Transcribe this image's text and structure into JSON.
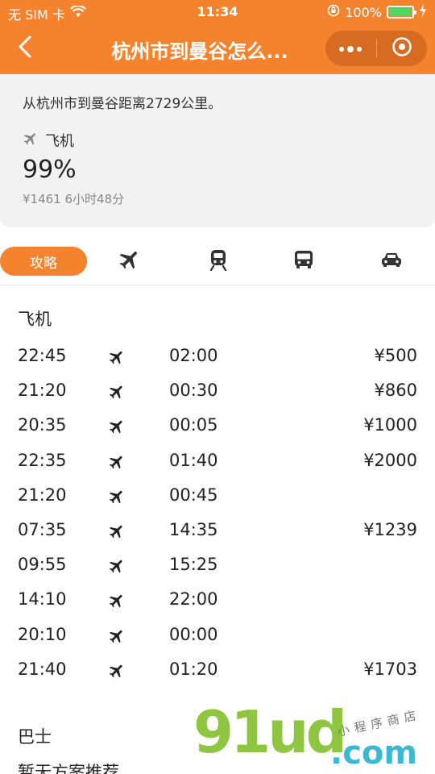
{
  "status_bar": {
    "carrier": "无 SIM 卡",
    "time": "11:34",
    "battery": "100%"
  },
  "nav": {
    "title": "杭州市到曼谷怎么..."
  },
  "summary": {
    "distance_text": "从杭州市到曼谷距离2729公里。",
    "mode_label": "飞机",
    "percent": "99%",
    "meta": "¥1461 6小时48分"
  },
  "tabs": {
    "guide_label": "攻略",
    "icons": [
      "plane-icon",
      "train-icon",
      "bus-icon",
      "car-icon"
    ]
  },
  "flights": {
    "title": "飞机",
    "rows": [
      {
        "dep": "22:45",
        "arr": "02:00",
        "price": "¥500"
      },
      {
        "dep": "21:20",
        "arr": "00:30",
        "price": "¥860"
      },
      {
        "dep": "20:35",
        "arr": "00:05",
        "price": "¥1000"
      },
      {
        "dep": "22:35",
        "arr": "01:40",
        "price": "¥2000"
      },
      {
        "dep": "21:20",
        "arr": "00:45",
        "price": ""
      },
      {
        "dep": "07:35",
        "arr": "14:35",
        "price": "¥1239"
      },
      {
        "dep": "09:55",
        "arr": "15:25",
        "price": ""
      },
      {
        "dep": "14:10",
        "arr": "22:00",
        "price": ""
      },
      {
        "dep": "20:10",
        "arr": "00:00",
        "price": ""
      },
      {
        "dep": "21:40",
        "arr": "01:20",
        "price": "¥1703"
      }
    ]
  },
  "bus": {
    "title": "巴士",
    "empty_text": "暂无方案推荐"
  },
  "watermark": {
    "brand": "91ud",
    "domain": ".com",
    "tagline": "小程序商店"
  },
  "colors": {
    "accent": "#f5822c",
    "watermark_green": "#8ec641",
    "watermark_cyan": "#3bb9d3"
  }
}
